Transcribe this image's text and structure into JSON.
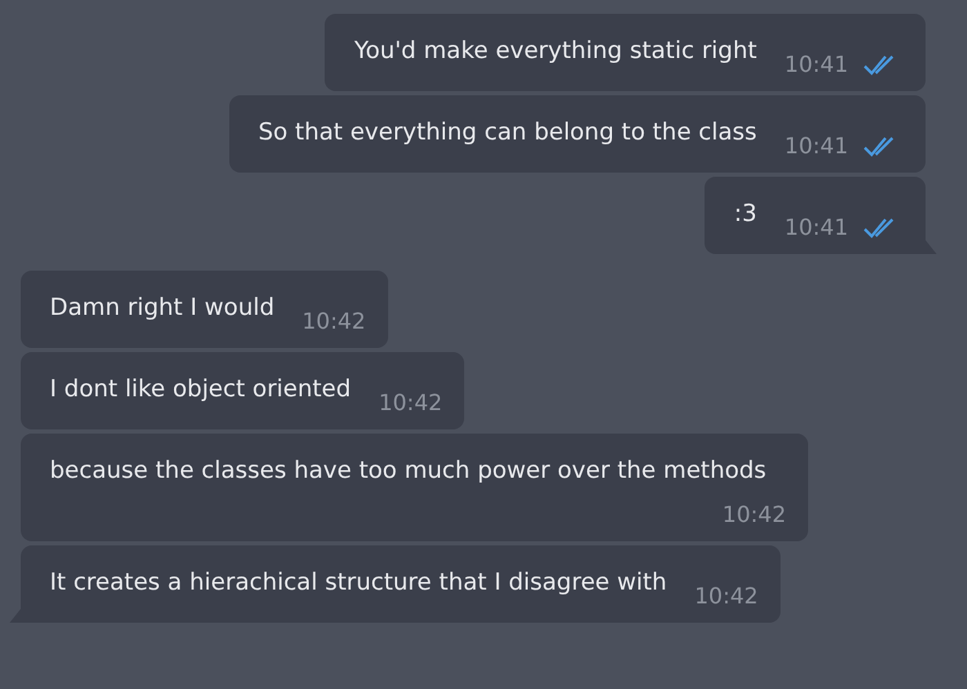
{
  "messages": [
    {
      "kind": "out",
      "text": "You'd make everything static right",
      "time": "10:41",
      "read": true,
      "tail": false
    },
    {
      "kind": "out",
      "text": "So that everything can belong to the class",
      "time": "10:41",
      "read": true,
      "tail": false
    },
    {
      "kind": "out",
      "text": ":3",
      "time": "10:41",
      "read": true,
      "tail": true
    },
    {
      "kind": "in",
      "text": "Damn right I would",
      "time": "10:42",
      "tail": false
    },
    {
      "kind": "in",
      "text": "I dont like object oriented",
      "time": "10:42",
      "tail": false
    },
    {
      "kind": "in",
      "text": "because the classes have too much power over the methods",
      "time": "10:42",
      "tail": false
    },
    {
      "kind": "in",
      "text": "It creates a hierachical structure that I disagree with",
      "time": "10:42",
      "tail": true
    }
  ]
}
